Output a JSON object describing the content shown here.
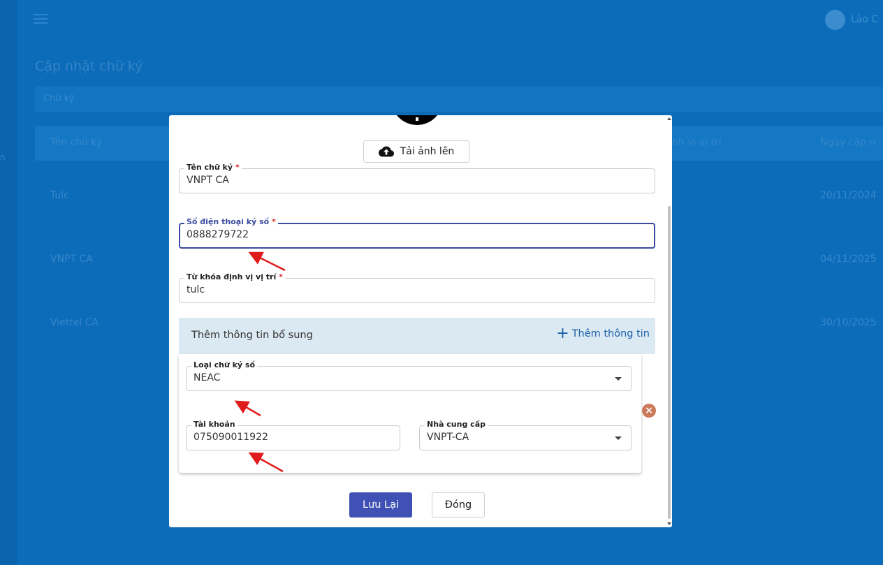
{
  "background": {
    "username": "Lào C",
    "page_title": "Cập nhật chữ ký",
    "search_placeholder": "Chữ ký",
    "table_headers": [
      "Tên chữ ký",
      "nh vị vị trí",
      "Ngày cập n"
    ],
    "rows": [
      {
        "name": "Tulc",
        "date": "20/11/2024"
      },
      {
        "name": "VNPT CA",
        "date": "04/11/2025"
      },
      {
        "name": "Viettel CA",
        "date": "30/10/2025"
      }
    ],
    "left_mark": "n"
  },
  "modal": {
    "upload_label": "Tải ảnh lên",
    "fields": {
      "name": {
        "label": "Tên chữ ký",
        "required": "*",
        "value": "VNPT CA"
      },
      "phone": {
        "label": "Số điện thoại ký số",
        "required": "*",
        "value": "0888279722"
      },
      "keyword": {
        "label": "Từ khóa định vị vị trí",
        "required": "*",
        "value": "tulc"
      }
    },
    "extra": {
      "title": "Thêm thông tin bổ sung",
      "add_icon": "+",
      "add_label": "Thêm thông tin"
    },
    "card": {
      "type": {
        "label": "Loại chữ ký số",
        "value": "NEAC"
      },
      "account": {
        "label": "Tài khoản",
        "value": "075090011922"
      },
      "provider": {
        "label": "Nhà cung cấp",
        "value": "VNPT-CA"
      },
      "remove_icon": "×"
    },
    "save_label": "Lưu Lại",
    "close_label": "Đóng"
  },
  "colors": {
    "primary": "#3f51b5",
    "focus_border": "#3a4a9e",
    "annotation_arrow": "#e01b1b",
    "overlay_background": "#0e6db9"
  }
}
